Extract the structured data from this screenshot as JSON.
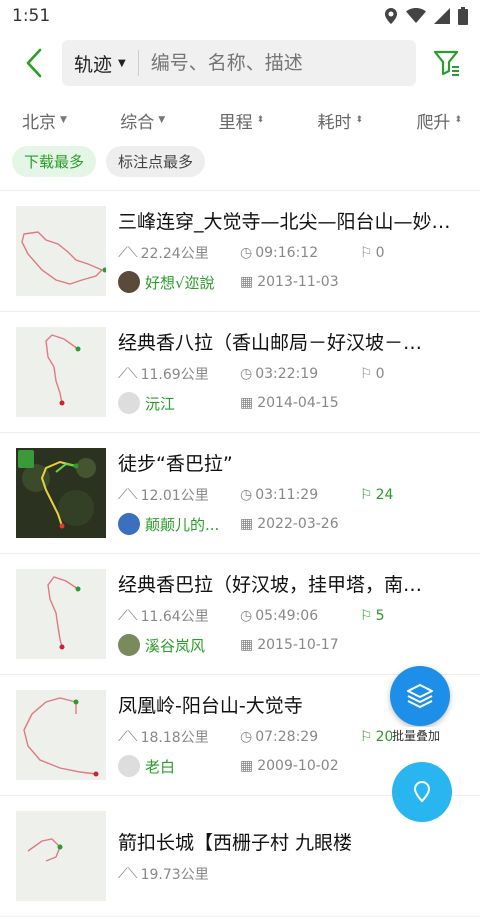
{
  "status_bar": {
    "time": "1:51"
  },
  "search": {
    "type_label": "轨迹",
    "placeholder": "编号、名称、描述"
  },
  "sort_options": [
    "北京",
    "综合",
    "里程",
    "耗时",
    "爬升"
  ],
  "chips": [
    {
      "label": "下载最多",
      "active": true
    },
    {
      "label": "标注点最多",
      "active": false
    }
  ],
  "tracks": [
    {
      "title": "三峰连穿_大觉寺—北尖—阳台山—妙…",
      "distance": "22.24公里",
      "duration": "09:16:12",
      "markers": "0",
      "author": "好想√迩說",
      "date": "2013-11-03"
    },
    {
      "title": "经典香八拉（香山邮局－好汉坡－…",
      "distance": "11.69公里",
      "duration": "03:22:19",
      "markers": "0",
      "author": "沅江",
      "date": "2014-04-15"
    },
    {
      "title": "徒步“香巴拉”",
      "distance": "12.01公里",
      "duration": "03:11:29",
      "markers": "24",
      "author": "颠颠儿的...",
      "date": "2022-03-26"
    },
    {
      "title": "经典香巴拉（好汉坡，挂甲塔，南…",
      "distance": "11.64公里",
      "duration": "05:49:06",
      "markers": "5",
      "author": "溪谷岚风",
      "date": "2015-10-17"
    },
    {
      "title": "凤凰岭-阳台山-大觉寺",
      "distance": "18.18公里",
      "duration": "07:28:29",
      "markers": "20",
      "author": "老白",
      "date": "2009-10-02"
    },
    {
      "title": "箭扣长城【西栅子村 九眼楼",
      "distance": "19.73公里",
      "duration": "",
      "markers": "",
      "author": "",
      "date": ""
    }
  ],
  "fab": {
    "layers_label": "批量叠加"
  },
  "colors": {
    "accent_green": "#2a9d2a",
    "fab_blue": "#1e8fe8"
  }
}
